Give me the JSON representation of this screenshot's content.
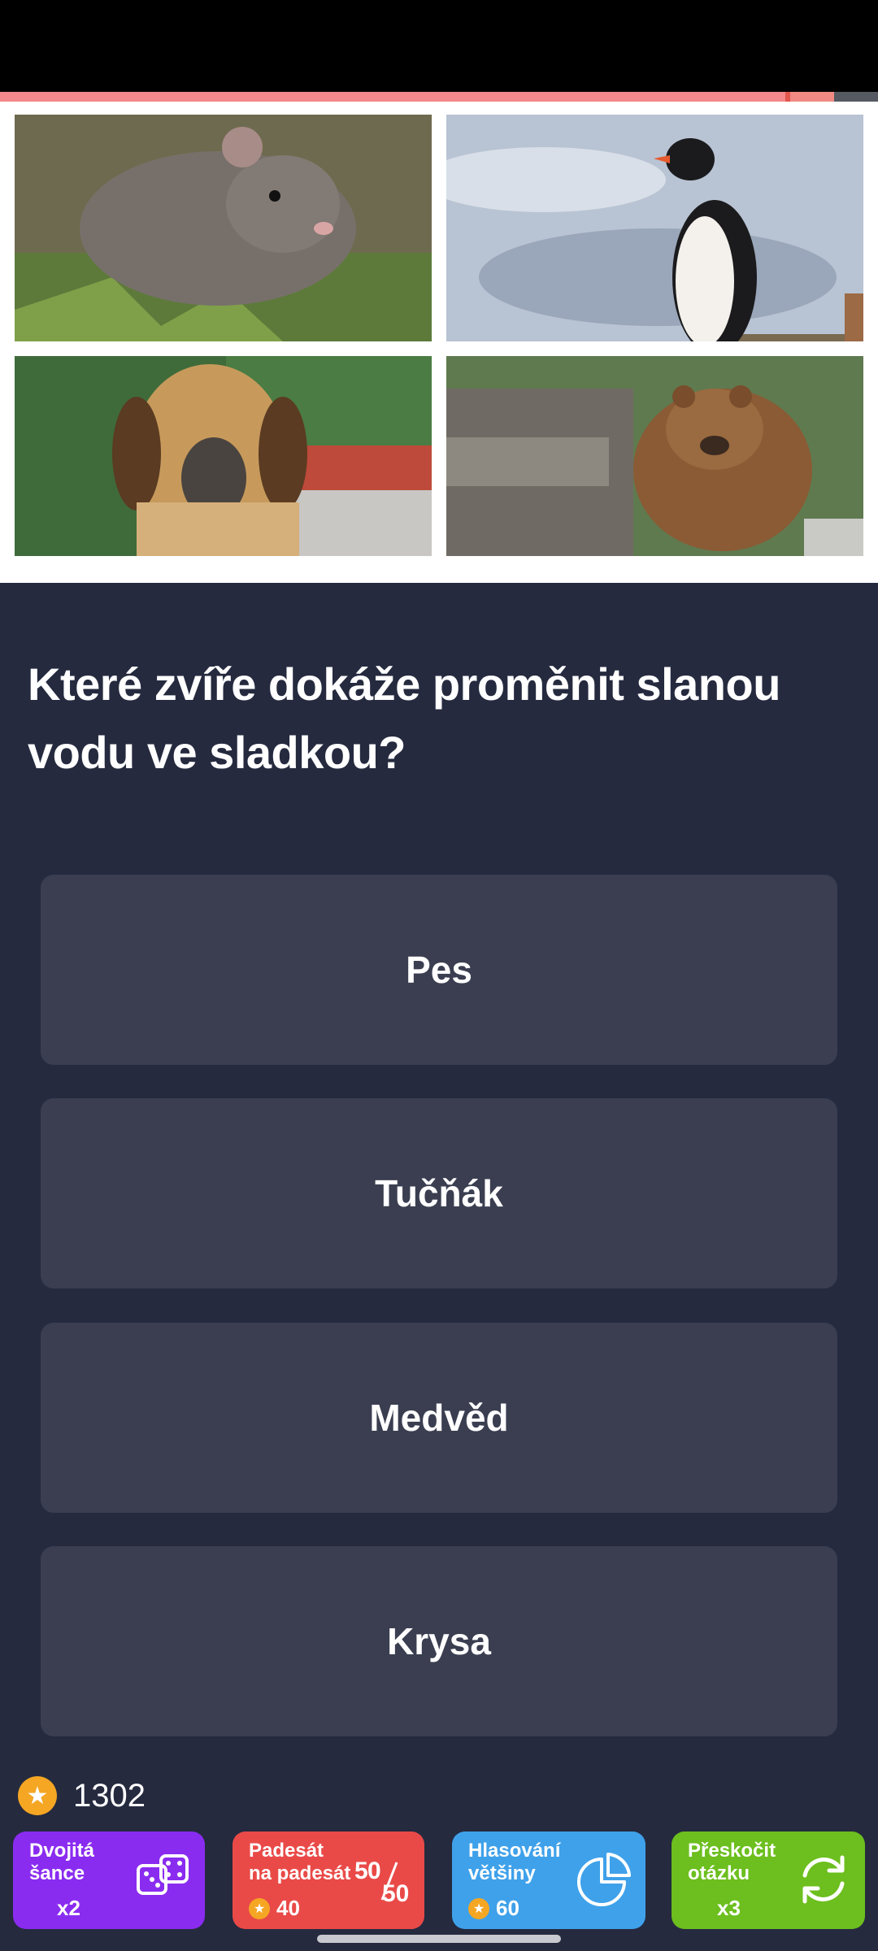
{
  "quiz": {
    "progress": 0.895,
    "question": "Které zvíře dokáže proměnit slanou vodu ve sladkou?",
    "images": [
      {
        "icon": "rat-photo"
      },
      {
        "icon": "penguin-photo"
      },
      {
        "icon": "dog-photo"
      },
      {
        "icon": "bear-photo"
      }
    ],
    "answers": [
      {
        "label": "Pes"
      },
      {
        "label": "Tučňák"
      },
      {
        "label": "Medvěd"
      },
      {
        "label": "Krysa"
      }
    ]
  },
  "wallet": {
    "coins": "1302",
    "coin_icon": "star-coin-icon"
  },
  "powerups": [
    {
      "label": "Dvojitá\nšance",
      "sub": "x2",
      "icon": "dice-icon",
      "color": "#8a2cf0"
    },
    {
      "label": "Padesát\nna padesát",
      "sub": "40",
      "icon": "fifty-fifty-icon",
      "color": "#e94a48"
    },
    {
      "label": "Hlasování\nvětšiny",
      "sub": "60",
      "icon": "pie-chart-icon",
      "color": "#3fa1ea"
    },
    {
      "label": "Přeskočit\notázku",
      "sub": "x3",
      "icon": "refresh-icon",
      "color": "#6cbf1e"
    }
  ],
  "colors": {
    "background": "#252a3f",
    "answer_bg": "#3a3e50",
    "progress": "#f4888a"
  }
}
